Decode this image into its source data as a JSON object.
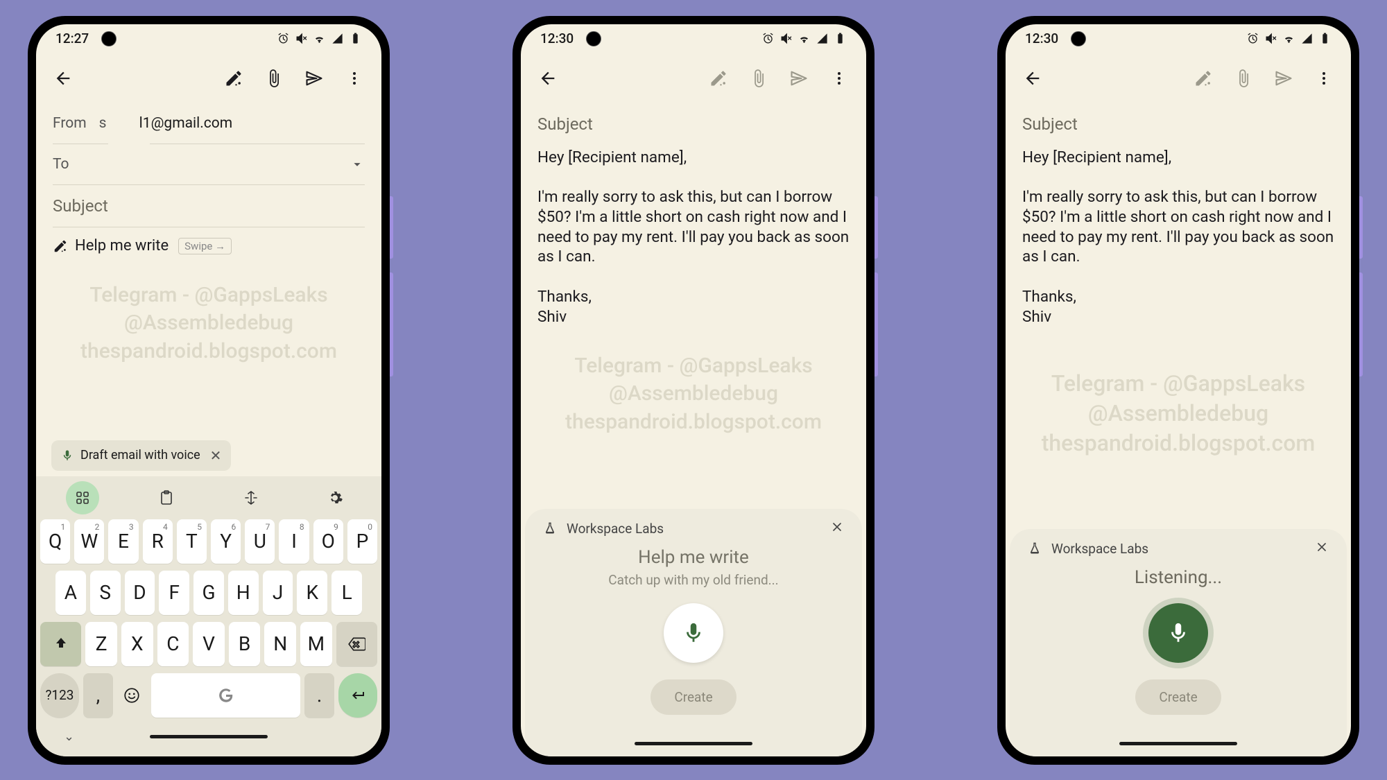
{
  "phone1": {
    "status": {
      "time": "12:27"
    },
    "fields": {
      "from_label": "From",
      "from_short": "s",
      "from_email": "l1@gmail.com",
      "to_label": "To",
      "subject_placeholder": "Subject"
    },
    "hmw": {
      "label": "Help me write",
      "swipe": "Swipe →"
    },
    "watermark": {
      "line1": "Telegram - @GappsLeaks",
      "line2": "@Assembledebug",
      "line3": "thespandroid.blogspot.com"
    },
    "voice_chip": {
      "label": "Draft email with voice"
    },
    "keyboard": {
      "row1": [
        {
          "k": "Q",
          "s": "1"
        },
        {
          "k": "W",
          "s": "2"
        },
        {
          "k": "E",
          "s": "3"
        },
        {
          "k": "R",
          "s": "4"
        },
        {
          "k": "T",
          "s": "5"
        },
        {
          "k": "Y",
          "s": "6"
        },
        {
          "k": "U",
          "s": "7"
        },
        {
          "k": "I",
          "s": "8"
        },
        {
          "k": "O",
          "s": "9"
        },
        {
          "k": "P",
          "s": "0"
        }
      ],
      "row2": [
        "A",
        "S",
        "D",
        "F",
        "G",
        "H",
        "J",
        "K",
        "L"
      ],
      "row3": [
        "Z",
        "X",
        "C",
        "V",
        "B",
        "N",
        "M"
      ],
      "sym": "?123",
      "comma": ",",
      "period": "."
    }
  },
  "phone2": {
    "status": {
      "time": "12:30"
    },
    "fields": {
      "subject_placeholder": "Subject"
    },
    "body": {
      "greeting": "Hey [Recipient name],",
      "para": "I'm really sorry to ask this, but can I borrow $50? I'm a little short on cash right now and I need to pay my rent. I'll pay you back as soon as I can.",
      "thanks": "Thanks,",
      "sign": "Shiv"
    },
    "watermark": {
      "line1": "Telegram - @GappsLeaks",
      "line2": "@Assembledebug",
      "line3": "thespandroid.blogspot.com"
    },
    "panel": {
      "labs": "Workspace Labs",
      "title": "Help me write",
      "sub": "Catch up with my old friend...",
      "create": "Create"
    }
  },
  "phone3": {
    "status": {
      "time": "12:30"
    },
    "fields": {
      "subject_placeholder": "Subject"
    },
    "body": {
      "greeting": "Hey [Recipient name],",
      "para": "I'm really sorry to ask this, but can I borrow $50? I'm a little short on cash right now and I need to pay my rent. I'll pay you back as soon as I can.",
      "thanks": "Thanks,",
      "sign": "Shiv"
    },
    "watermark": {
      "line1": "Telegram - @GappsLeaks",
      "line2": "@Assembledebug",
      "line3": "thespandroid.blogspot.com"
    },
    "panel": {
      "labs": "Workspace Labs",
      "listening": "Listening...",
      "create": "Create"
    }
  }
}
